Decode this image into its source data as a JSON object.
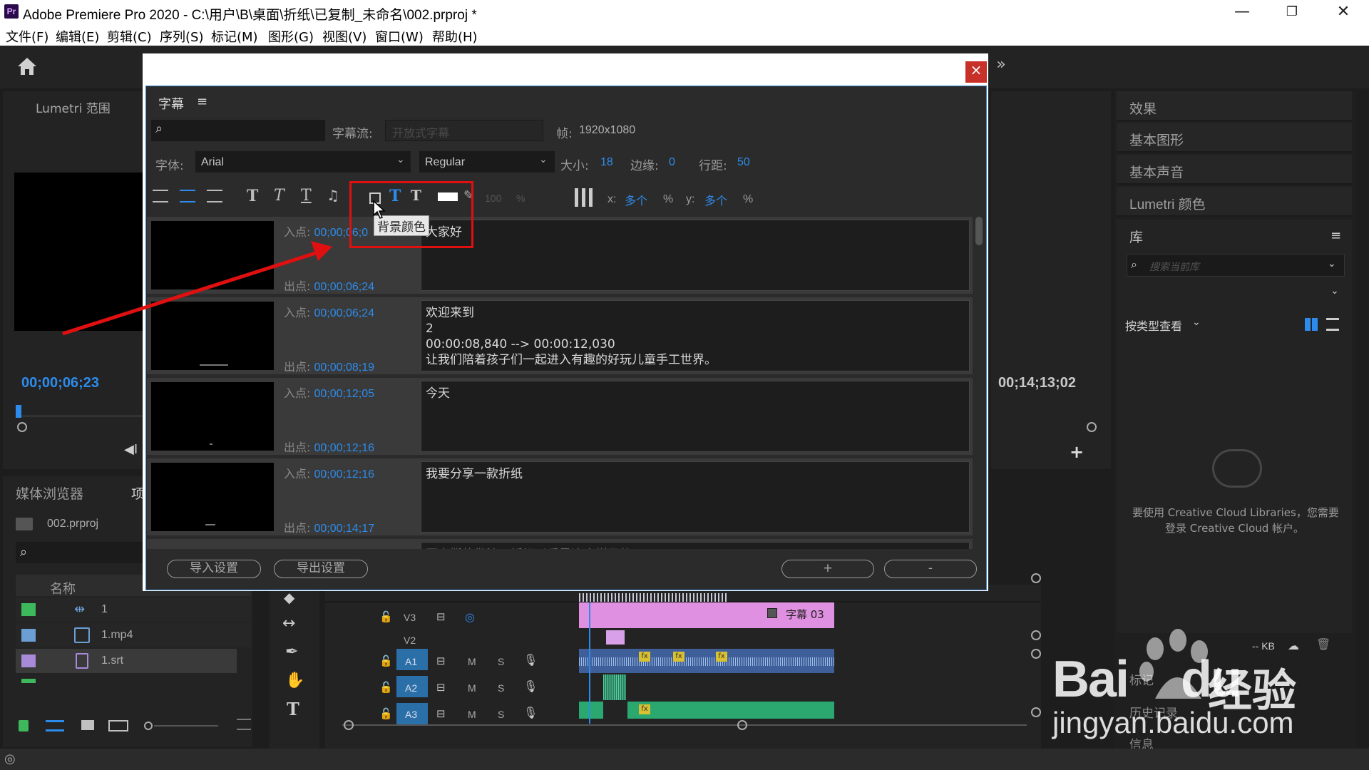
{
  "window": {
    "title": "Adobe Premiere Pro 2020 - C:\\用户\\B\\桌面\\折纸\\已复制_未命名\\002.prproj *",
    "app_icon": "Pr",
    "minimize": "—",
    "maximize": "❐",
    "close": "✕"
  },
  "menu": [
    "文件(F)",
    "编辑(E)",
    "剪辑(C)",
    "序列(S)",
    "标记(M)",
    "图形(G)",
    "视图(V)",
    "窗口(W)",
    "帮助(H)"
  ],
  "left_panel": {
    "tab": "Lumetri 范围",
    "timecode": "00;00;06;23",
    "media_tabs": [
      "媒体浏览器",
      "项"
    ],
    "project_file": "002.prproj",
    "col_name": "名称",
    "items": [
      {
        "name": "1",
        "color": "#3db85a"
      },
      {
        "name": "1.mp4",
        "color": "#6b9fd4"
      },
      {
        "name": "1.srt",
        "color": "#a78bd8"
      }
    ]
  },
  "program": {
    "timecode_right": "00;14;13;02"
  },
  "caption_dialog": {
    "panel_title": "字幕",
    "menu_icon": "≡",
    "search_placeholder": "",
    "stream_label": "字幕流:",
    "stream_value": "开放式字幕",
    "frame_label": "帧:",
    "frame_value": "1920x1080",
    "font_label": "字体:",
    "font_value": "Arial",
    "style_value": "Regular",
    "size_label": "大小:",
    "size_value": "18",
    "edge_label": "边缘:",
    "edge_value": "0",
    "line_label": "行距:",
    "line_value": "50",
    "opacity_value": "100",
    "opacity_unit": "%",
    "x_label": "x:",
    "x_value": "多个",
    "x_unit": "%",
    "y_label": "y:",
    "y_value": "多个",
    "y_unit": "%",
    "tooltip": "背景颜色",
    "in_label": "入点:",
    "out_label": "出点:",
    "captions": [
      {
        "in": "00;00;06;0",
        "out": "00;00;06;24",
        "text": "大家好"
      },
      {
        "in": "00;00;06;24",
        "out": "00;00;08;19",
        "text": "欢迎来到\n2\n00:00:08,840 --> 00:00:12,030\n让我们陪着孩子们一起进入有趣的好玩儿童手工世界。"
      },
      {
        "in": "00;00;12;05",
        "out": "00;00;12;16",
        "text": "今天"
      },
      {
        "in": "00;00;12;16",
        "out": "00;00;14;17",
        "text": "我要分享一款折纸"
      },
      {
        "in": "",
        "out": "",
        "text": "开支撕的做法，折好以后是这个样子的"
      }
    ],
    "import_btn": "导入设置",
    "export_btn": "导出设置",
    "add_btn": "+",
    "remove_btn": "-"
  },
  "right_panel": {
    "items": [
      "效果",
      "基本图形",
      "基本声音",
      "Lumetri 颜色"
    ],
    "library_title": "库",
    "library_search_placeholder": "搜索当前库",
    "view_by": "按类型查看",
    "cc_message_1": "要使用 Creative Cloud Libraries，您需要",
    "cc_message_2": "登录 Creative Cloud 帐户。",
    "kb_label": "-- KB",
    "bottom_items": [
      "标记",
      "历史记录",
      "信息"
    ]
  },
  "timeline": {
    "tracks": [
      {
        "name": "V3"
      },
      {
        "name": "V2"
      },
      {
        "name": "A1"
      },
      {
        "name": "A2"
      },
      {
        "name": "A3"
      }
    ],
    "track_m": "M",
    "track_s": "S",
    "caption_clip": "字幕 03"
  },
  "watermark": {
    "brand": "Bai",
    "brand2": "du",
    "cn": "经验",
    "url": "jingyan.baidu.com"
  }
}
